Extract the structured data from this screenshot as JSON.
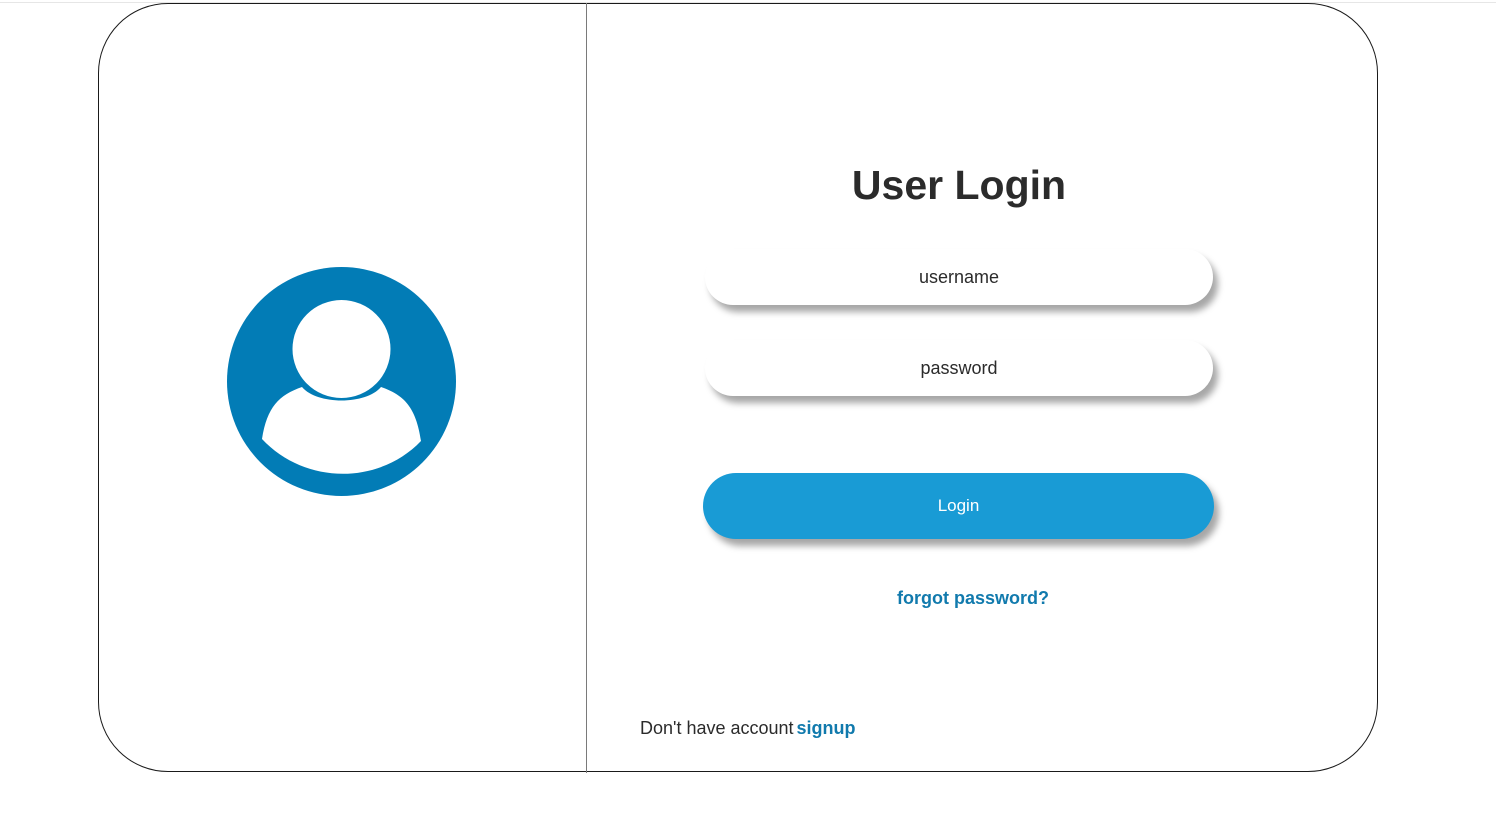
{
  "colors": {
    "accent": "#199bd5",
    "link": "#117aad",
    "avatar": "#027cb6",
    "text": "#2b2b2b"
  },
  "left_panel": {
    "icon": "user-avatar-icon"
  },
  "login_form": {
    "title": "User Login",
    "username_placeholder": "username",
    "password_placeholder": "password",
    "login_label": "Login",
    "forgot_label": "forgot password?",
    "signup_prompt": "Don't have account",
    "signup_label": "signup"
  }
}
